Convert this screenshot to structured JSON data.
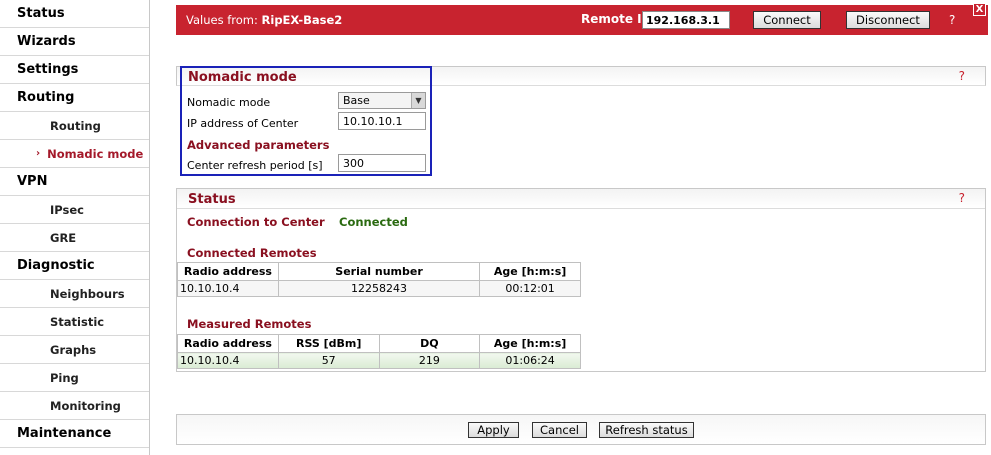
{
  "sidebar": {
    "items": [
      {
        "label": "Status",
        "level": "top"
      },
      {
        "label": "Wizards",
        "level": "top"
      },
      {
        "label": "Settings",
        "level": "top"
      },
      {
        "label": "Routing",
        "level": "top"
      },
      {
        "label": "Routing",
        "level": "sub"
      },
      {
        "label": "Nomadic mode",
        "level": "sub",
        "active": true
      },
      {
        "label": "VPN",
        "level": "top"
      },
      {
        "label": "IPsec",
        "level": "sub"
      },
      {
        "label": "GRE",
        "level": "sub"
      },
      {
        "label": "Diagnostic",
        "level": "top"
      },
      {
        "label": "Neighbours",
        "level": "sub"
      },
      {
        "label": "Statistic",
        "level": "sub"
      },
      {
        "label": "Graphs",
        "level": "sub"
      },
      {
        "label": "Ping",
        "level": "sub"
      },
      {
        "label": "Monitoring",
        "level": "sub"
      },
      {
        "label": "Maintenance",
        "level": "top"
      }
    ],
    "active_marker": "›"
  },
  "header": {
    "values_prefix": "Values from: ",
    "values_device": "RipEX-Base2",
    "remote_ip_label": "Remote IP",
    "remote_ip_value": "192.168.3.1",
    "connect_label": "Connect",
    "disconnect_label": "Disconnect",
    "help": "?",
    "close": "X"
  },
  "nomadic": {
    "title": "Nomadic mode",
    "help": "?",
    "mode_label": "Nomadic mode",
    "mode_value": "Base",
    "ip_label": "IP address of Center",
    "ip_value": "10.10.10.1",
    "advanced_label": "Advanced parameters",
    "refresh_label": "Center refresh period [s]",
    "refresh_value": "300"
  },
  "status": {
    "title": "Status",
    "help": "?",
    "conn_label": "Connection to Center",
    "conn_value": "Connected",
    "connected_remotes_title": "Connected Remotes",
    "connected_remotes": {
      "headers": [
        "Radio address",
        "Serial number",
        "Age [h:m:s]"
      ],
      "rows": [
        [
          "10.10.10.4",
          "12258243",
          "00:12:01"
        ]
      ]
    },
    "measured_remotes_title": "Measured Remotes",
    "measured_remotes": {
      "headers": [
        "Radio address",
        "RSS [dBm]",
        "DQ",
        "Age [h:m:s]"
      ],
      "rows": [
        [
          "10.10.10.4",
          "57",
          "219",
          "01:06:24"
        ]
      ]
    }
  },
  "buttons": {
    "apply": "Apply",
    "cancel": "Cancel",
    "refresh": "Refresh status"
  },
  "colors": {
    "header_bg": "#c8232f",
    "title_red": "#8a1020",
    "connected_green": "#2a6a10",
    "highlight_box": "#1a22b8"
  }
}
